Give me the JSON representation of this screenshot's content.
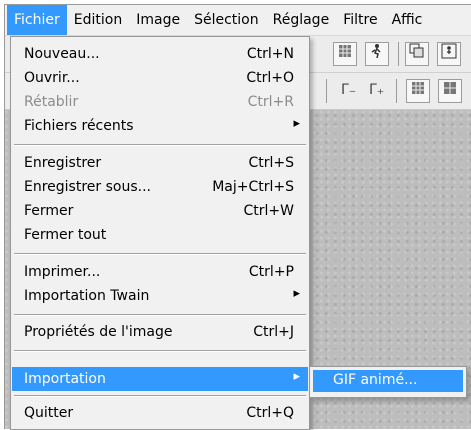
{
  "menubar": {
    "items": [
      "Fichier",
      "Edition",
      "Image",
      "Sélection",
      "Réglage",
      "Filtre",
      "Affic"
    ]
  },
  "toolbar2": {
    "gamma_minus_label": "Γ₋",
    "gamma_plus_label": "Γ₊"
  },
  "file_menu": {
    "items": [
      {
        "label": "Nouveau...",
        "shortcut": "Ctrl+N"
      },
      {
        "label": "Ouvrir...",
        "shortcut": "Ctrl+O"
      },
      {
        "label": "Rétablir",
        "shortcut": "Ctrl+R",
        "disabled": true
      },
      {
        "label": "Fichiers récents",
        "submenu_arrow": "▸"
      },
      {
        "label": "Enregistrer",
        "shortcut": "Ctrl+S"
      },
      {
        "label": "Enregistrer sous...",
        "shortcut": "Maj+Ctrl+S"
      },
      {
        "label": "Fermer",
        "shortcut": "Ctrl+W"
      },
      {
        "label": "Fermer tout"
      },
      {
        "label": "Imprimer...",
        "shortcut": "Ctrl+P"
      },
      {
        "label": "Importation Twain",
        "submenu_arrow": "▸"
      },
      {
        "label": "Propriétés de l'image",
        "shortcut": "Ctrl+J"
      },
      {
        "label": "Importation",
        "submenu_arrow": "▸",
        "highlighted": true
      },
      {
        "label": "Quitter",
        "shortcut": "Ctrl+Q"
      }
    ]
  },
  "import_submenu": {
    "items": [
      {
        "label": "GIF animé..."
      }
    ]
  },
  "colors": {
    "highlight": "#3399ff",
    "menu_background": "#f1f1f1",
    "disabled_text": "#8c8c8c"
  }
}
